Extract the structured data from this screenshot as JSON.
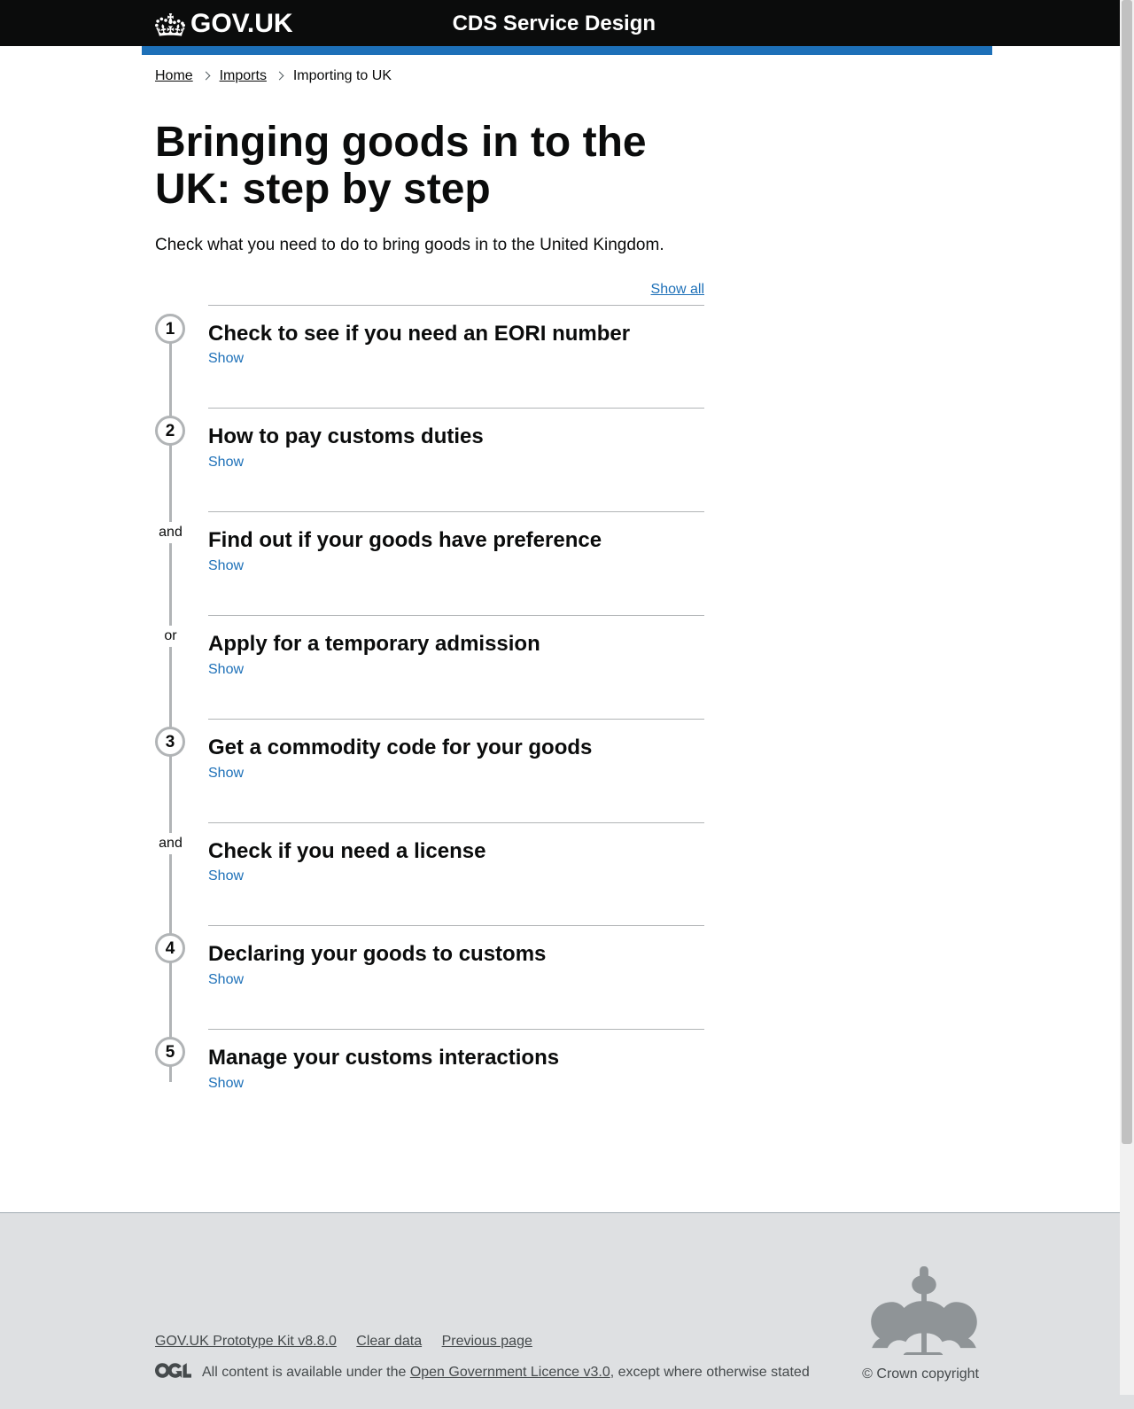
{
  "header": {
    "logo_text": "GOV.UK",
    "service_name": "CDS Service Design"
  },
  "breadcrumbs": {
    "items": [
      {
        "label": "Home",
        "link": true
      },
      {
        "label": "Imports",
        "link": true
      },
      {
        "label": "Importing to UK",
        "link": false
      }
    ]
  },
  "page": {
    "title": "Bringing goods in to the UK: step by step",
    "intro": "Check what you need to do to bring goods in to the United Kingdom.",
    "show_all": "Show all"
  },
  "steps": [
    {
      "marker": "1",
      "type": "number",
      "title": "Check to see if you need an EORI number",
      "toggle": "Show"
    },
    {
      "marker": "2",
      "type": "number",
      "title": "How to pay customs duties",
      "toggle": "Show"
    },
    {
      "marker": "and",
      "type": "logic",
      "title": "Find out if your goods have preference",
      "toggle": "Show"
    },
    {
      "marker": "or",
      "type": "logic",
      "title": "Apply for a temporary admission",
      "toggle": "Show"
    },
    {
      "marker": "3",
      "type": "number",
      "title": "Get a commodity code for your goods",
      "toggle": "Show"
    },
    {
      "marker": "and",
      "type": "logic",
      "title": "Check if you need a license",
      "toggle": "Show"
    },
    {
      "marker": "4",
      "type": "number",
      "title": "Declaring your goods to customs",
      "toggle": "Show"
    },
    {
      "marker": "5",
      "type": "number",
      "title": "Manage your customs interactions",
      "toggle": "Show"
    }
  ],
  "footer": {
    "links": [
      "GOV.UK Prototype Kit v8.8.0",
      "Clear data",
      "Previous page"
    ],
    "licence_prefix": "All content is available under the ",
    "licence_link": "Open Government Licence v3.0",
    "licence_suffix": ", except where otherwise stated",
    "copyright": "© Crown copyright"
  }
}
